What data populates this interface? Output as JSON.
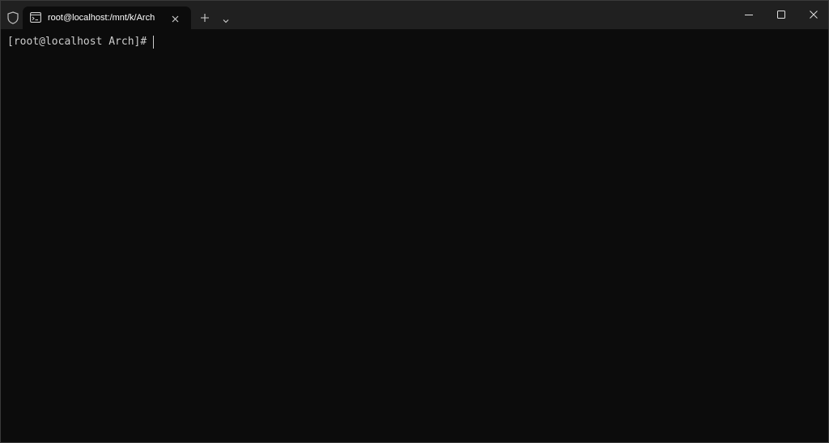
{
  "window": {
    "tab_title": "root@localhost:/mnt/k/Arch",
    "icons": {
      "shield": "shield-icon",
      "tab": "terminal-icon",
      "close_tab": "close-icon",
      "new_tab": "plus-icon",
      "dropdown": "chevron-down-icon",
      "minimize": "minimize-icon",
      "maximize": "maximize-icon",
      "close_window": "close-icon"
    }
  },
  "terminal": {
    "prompt": "[root@localhost Arch]#"
  },
  "colors": {
    "background": "#0c0c0c",
    "titlebar": "#202020",
    "text": "#cccccc"
  }
}
